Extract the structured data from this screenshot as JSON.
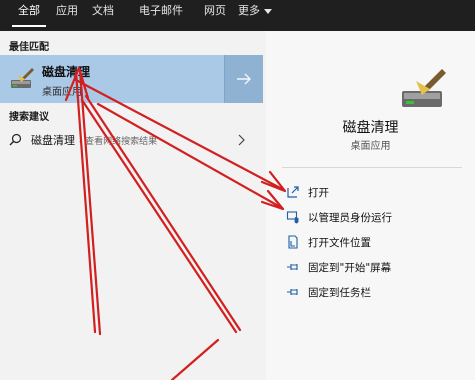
{
  "tabs": [
    {
      "label": "全部",
      "active": true
    },
    {
      "label": "应用"
    },
    {
      "label": "文档"
    },
    {
      "label": "电子邮件"
    },
    {
      "label": "网页"
    },
    {
      "label": "更多"
    }
  ],
  "left": {
    "best_match_label": "最佳匹配",
    "best_match": {
      "title": "磁盘清理",
      "subtitle": "桌面应用",
      "icon": "disk-cleanup-icon"
    },
    "suggest_label": "搜索建议",
    "suggestion": {
      "text": "磁盘清理",
      "hint": "- 查看网络搜索结果",
      "icon": "search-icon"
    }
  },
  "right": {
    "title": "磁盘清理",
    "subtitle": "桌面应用",
    "actions": [
      {
        "label": "打开",
        "icon": "open-icon"
      },
      {
        "label": "以管理员身份运行",
        "icon": "shield-icon"
      },
      {
        "label": "打开文件位置",
        "icon": "file-location-icon"
      },
      {
        "label": "固定到\"开始\"屏幕",
        "icon": "pin-icon"
      },
      {
        "label": "固定到任务栏",
        "icon": "pin-icon"
      }
    ]
  },
  "colors": {
    "topbar": "#1f1f1f",
    "highlight": "#a9c9e6",
    "accent_icon": "#1f5fa8",
    "annotation": "#d21f1f"
  }
}
